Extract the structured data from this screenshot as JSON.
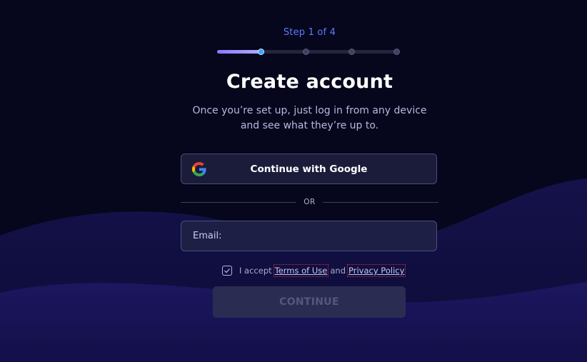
{
  "stepper": {
    "label": "Step 1 of 4",
    "current_step": 1,
    "total_steps": 4,
    "fill_color": "#8a7bff",
    "active_dot_color": "#35a8ff"
  },
  "header": {
    "title": "Create account",
    "subtitle": "Once you’re set up, just log in from any device and see what they’re up to."
  },
  "google": {
    "label": "Continue with Google",
    "icon": "google-logo-icon"
  },
  "divider": {
    "label": "OR"
  },
  "email": {
    "placeholder": "Email:",
    "value": ""
  },
  "terms": {
    "checked": false,
    "prefix": "I accept",
    "terms_link": "Terms of Use",
    "conjunction": "and",
    "privacy_link": "Privacy Policy"
  },
  "continue": {
    "label": "CONTINUE",
    "disabled": true
  },
  "colors": {
    "background": "#06061c",
    "accent": "#5b7cff"
  }
}
